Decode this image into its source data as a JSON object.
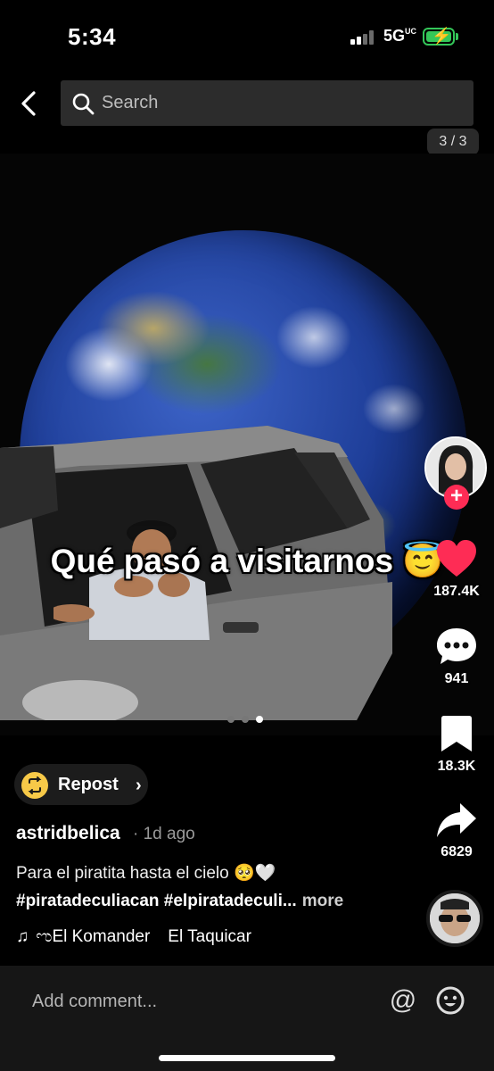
{
  "status_bar": {
    "time": "5:34",
    "network": "5G",
    "network_sup": "UC",
    "battery_color": "#34c759"
  },
  "header": {
    "back_icon": "chevron-left-icon",
    "search": {
      "placeholder": "Search",
      "value": ""
    },
    "page_counter": "3 / 3"
  },
  "post": {
    "caption_text": "Qué pasó a visitarnos 😇",
    "carousel": {
      "count": 3,
      "active": 3
    },
    "actions": {
      "likes": "187.4K",
      "comments": "941",
      "saves": "18.3K",
      "shares": "6829",
      "like_color": "#fe2c55"
    },
    "repost": {
      "label": "Repost"
    },
    "username": "astridbelica",
    "time_ago": "· 1d ago",
    "description": "Para el piratita hasta el cielo 🥺🤍",
    "hashtags": "#piratadeculiacan #elpiratadeculi...",
    "more_label": "more",
    "music": {
      "title": "ಌEl Komander",
      "title_2": "El Taquicar"
    }
  },
  "comment_bar": {
    "placeholder": "Add comment...",
    "mention_icon": "at-icon",
    "emoji_icon": "emoji-icon"
  }
}
